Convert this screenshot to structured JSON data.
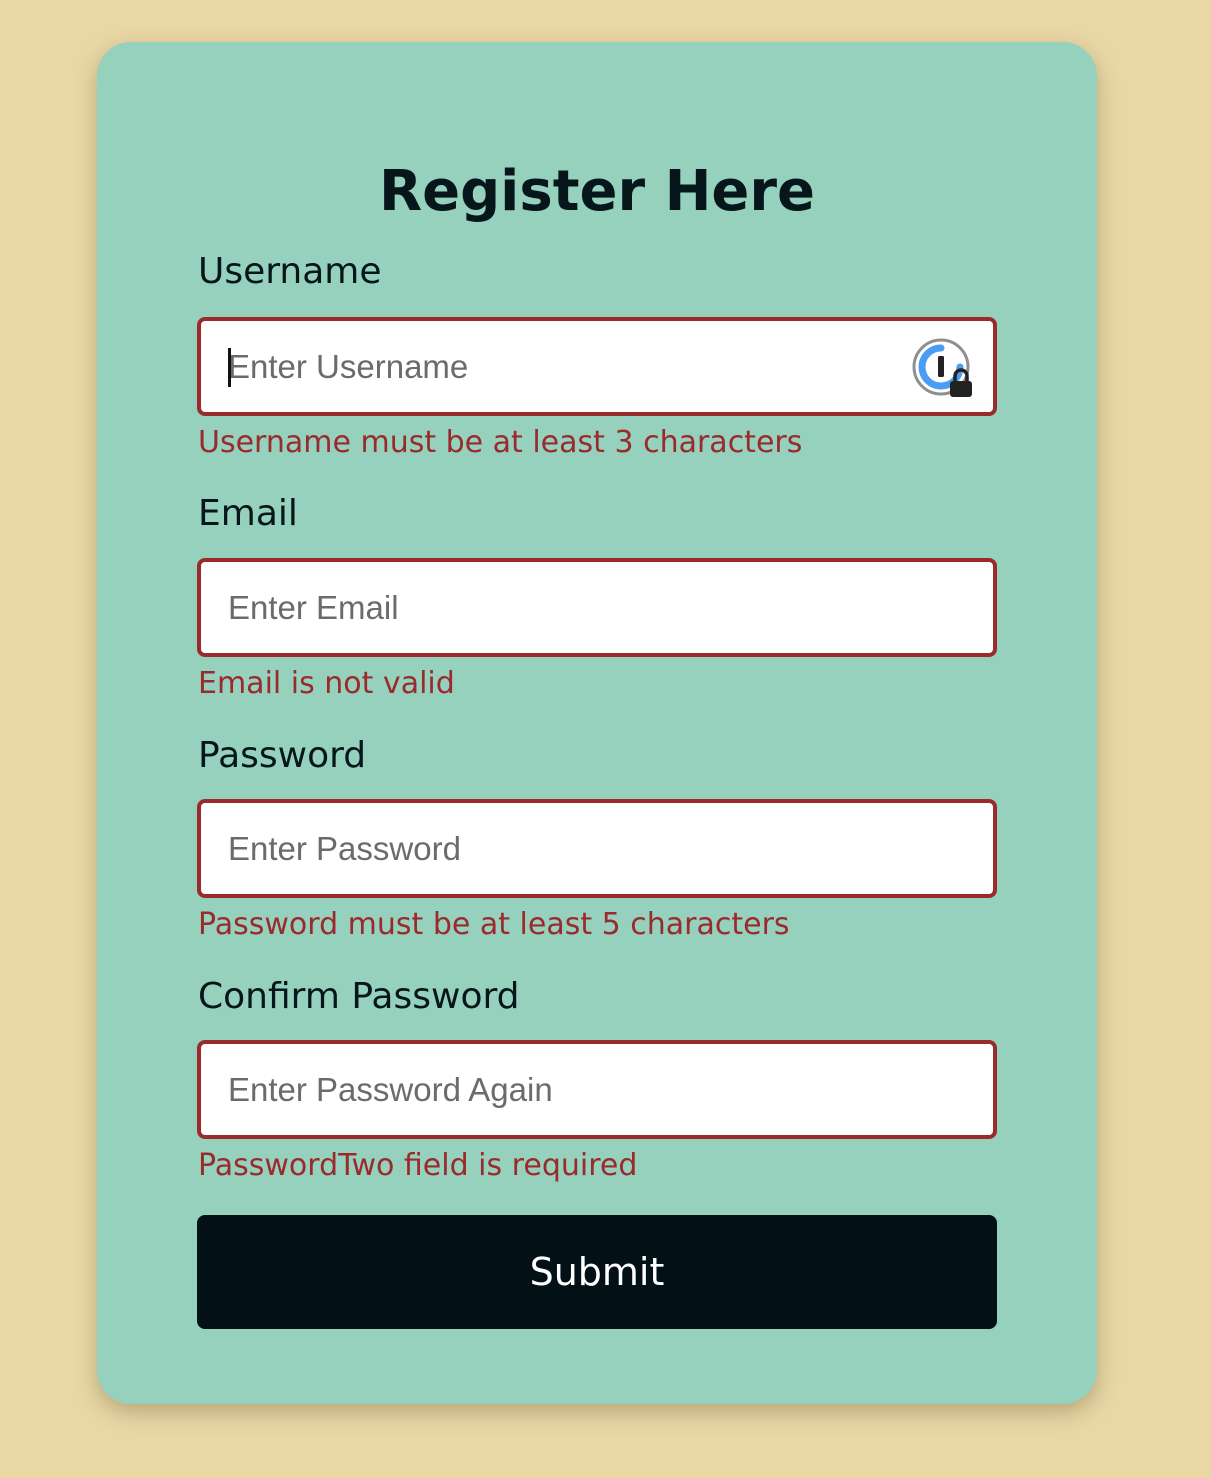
{
  "form": {
    "title": "Register Here",
    "fields": [
      {
        "label": "Username",
        "placeholder": "Enter Username",
        "value": "",
        "error": "Username must be at least 3 characters",
        "password_manager_icon": "password-manager-lock-icon"
      },
      {
        "label": "Email",
        "placeholder": "Enter Email",
        "value": "",
        "error": "Email is not valid"
      },
      {
        "label": "Password",
        "placeholder": "Enter Password",
        "value": "",
        "error": "Password must be at least 5 characters"
      },
      {
        "label": "Confirm Password",
        "placeholder": "Enter Password Again",
        "value": "",
        "error": "PasswordTwo field is required"
      }
    ],
    "submit_label": "Submit"
  },
  "colors": {
    "page_background": "#e9d7a6",
    "card_background": "#95d1bd",
    "error": "#9a2a2c",
    "button_background": "#031117",
    "button_text": "#ffffff"
  }
}
